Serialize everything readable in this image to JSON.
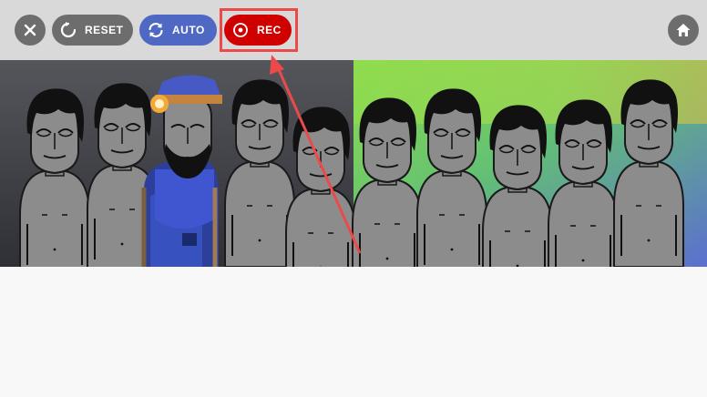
{
  "toolbar": {
    "close_icon": "close-icon",
    "reset_label": "RESET",
    "reset_icon": "reset-icon",
    "auto_label": "AUTO",
    "auto_icon": "sync-icon",
    "rec_label": "REC",
    "rec_icon": "record-icon",
    "home_icon": "home-icon"
  },
  "colors": {
    "toolbar_bg": "#d9d9d9",
    "button_gray": "#6d6d6d",
    "auto_blue": "#4f68c4",
    "rec_red": "#d00000",
    "highlight_red": "#ea4a4a",
    "stage_left_bg": "#3e3f45",
    "stage_right_bg_top": "#7fd34e",
    "stage_right_bg_bottom": "#5a78c8",
    "character_body": "#8c8c8c",
    "character_hair": "#111111",
    "hat_blue": "#4759c4"
  },
  "stage": {
    "characters": 11,
    "special_character_index": 2
  }
}
